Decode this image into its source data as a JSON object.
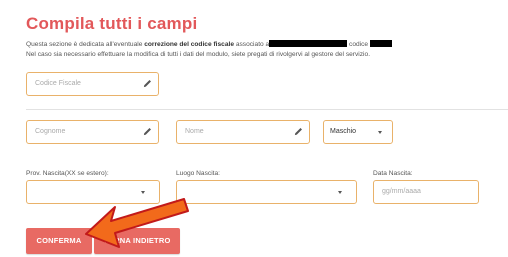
{
  "header": {
    "title": "Compila tutti i campi",
    "desc_line1_pre": "Questa sezione è dedicata all'eventuale ",
    "desc_line1_bold": "correzione del codice fiscale",
    "desc_line1_mid": " associato a",
    "desc_line1_post": " codice",
    "desc_line2": "Nel caso sia necessario effettuare la modifica di tutti i dati del modulo, siete pregati di rivolgervi al gestore del servizio."
  },
  "form": {
    "codice_fiscale_placeholder": "Codice Fiscale",
    "cognome_placeholder": "Cognome",
    "nome_placeholder": "Nome",
    "sesso_value": "Maschio",
    "prov_label": "Prov. Nascita(XX se estero):",
    "luogo_label": "Luogo Nascita:",
    "data_label": "Data Nascita:",
    "data_placeholder": "gg/mm/aaaa"
  },
  "buttons": {
    "confirm_label": "CONFERMA",
    "back_label": "TORNA INDIETRO"
  },
  "colors": {
    "accent": "#e2585a",
    "button": "#e86a63",
    "field_border": "#e9b26a",
    "arrow": "#f26a1b"
  },
  "icons": [
    "pencil-icon",
    "chevron-down-icon",
    "arrow-annotation"
  ]
}
